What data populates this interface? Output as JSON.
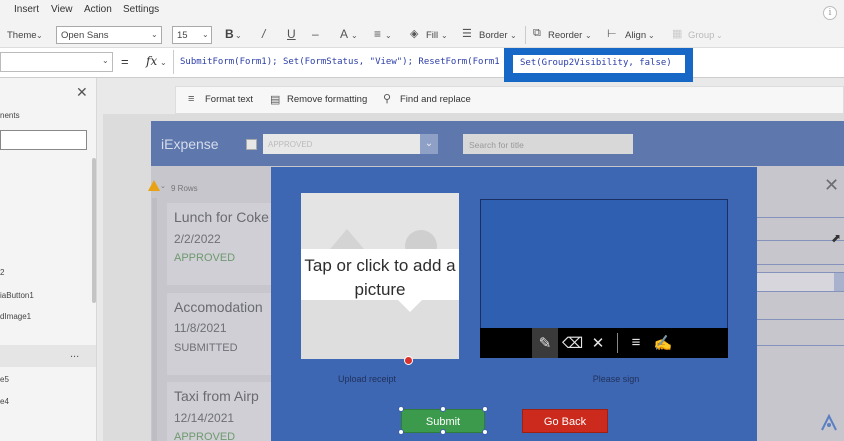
{
  "menu": [
    "Insert",
    "View",
    "Action",
    "Settings"
  ],
  "ribbon": {
    "theme_label": "Theme",
    "font_name": "Open Sans",
    "font_size": "15",
    "bold": "B",
    "italic": "/",
    "underline": "U",
    "strikethrough": "–",
    "font_color": "A",
    "fill_label": "Fill",
    "border_label": "Border",
    "reorder_label": "Reorder",
    "align_label": "Align",
    "group_label": "Group"
  },
  "formula_bar": {
    "fx": "fx",
    "equals": "=",
    "formula": "SubmitForm(Form1); Set(FormStatus, \"View\"); ResetForm(Form1",
    "highlighted": "Set(Group2Visibility, false)"
  },
  "format_row": {
    "format_text": "Format text",
    "remove_formatting": "Remove formatting",
    "find_replace": "Find and replace"
  },
  "left_panel": {
    "items": [
      "nents",
      "2",
      "iaButton1",
      "dImage1",
      "e5",
      "e4"
    ],
    "more": "..."
  },
  "app": {
    "title": "iExpense",
    "status_filter": "APPROVED",
    "search_placeholder": "Search for title",
    "rows_count": "9 Rows",
    "cards": [
      {
        "title": "Lunch for Coke",
        "date": "2/2/2022",
        "status": "APPROVED"
      },
      {
        "title": "Accomodation",
        "date": "11/8/2021",
        "status": "SUBMITTED"
      },
      {
        "title": "Taxi from Airp",
        "date": "12/14/2021",
        "status": "APPROVED"
      }
    ]
  },
  "dialog": {
    "image_prompt": "Tap or click to add a picture",
    "upload_label": "Upload receipt",
    "sign_label": "Please sign",
    "submit_label": "Submit",
    "go_back_label": "Go Back"
  },
  "colors": {
    "accent": "#1767c7",
    "dialog_bg": "#3d67b3",
    "submit": "#3c9a4c",
    "go_back": "#cc2a1c"
  }
}
